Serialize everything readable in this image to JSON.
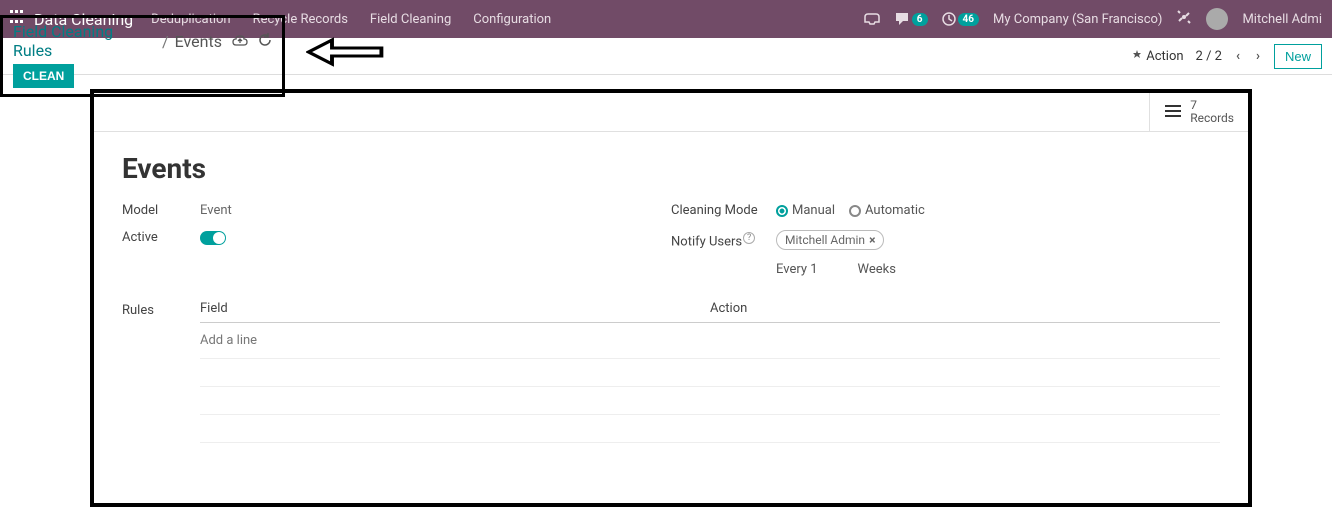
{
  "navbar": {
    "brand": "Data Cleaning",
    "menu": [
      "Deduplication",
      "Recycle Records",
      "Field Cleaning",
      "Configuration"
    ],
    "msg_badge": "6",
    "clock_badge": "46",
    "company": "My Company (San Francisco)",
    "user": "Mitchell Admi"
  },
  "breadcrumb": {
    "parent": "Field Cleaning Rules",
    "current": "Events"
  },
  "buttons": {
    "clean": "CLEAN",
    "action": "Action",
    "new": "New"
  },
  "pager": {
    "text": "2 / 2"
  },
  "stat": {
    "count": "7",
    "label": "Records"
  },
  "form": {
    "title": "Events",
    "model_label": "Model",
    "model_value": "Event",
    "active_label": "Active",
    "mode_label": "Cleaning Mode",
    "mode_manual": "Manual",
    "mode_auto": "Automatic",
    "notify_label": "Notify Users",
    "notify_user": "Mitchell Admin",
    "interval_every": "Every 1",
    "interval_unit": "Weeks",
    "rules_label": "Rules",
    "col_field": "Field",
    "col_action": "Action",
    "add_line": "Add a line"
  }
}
